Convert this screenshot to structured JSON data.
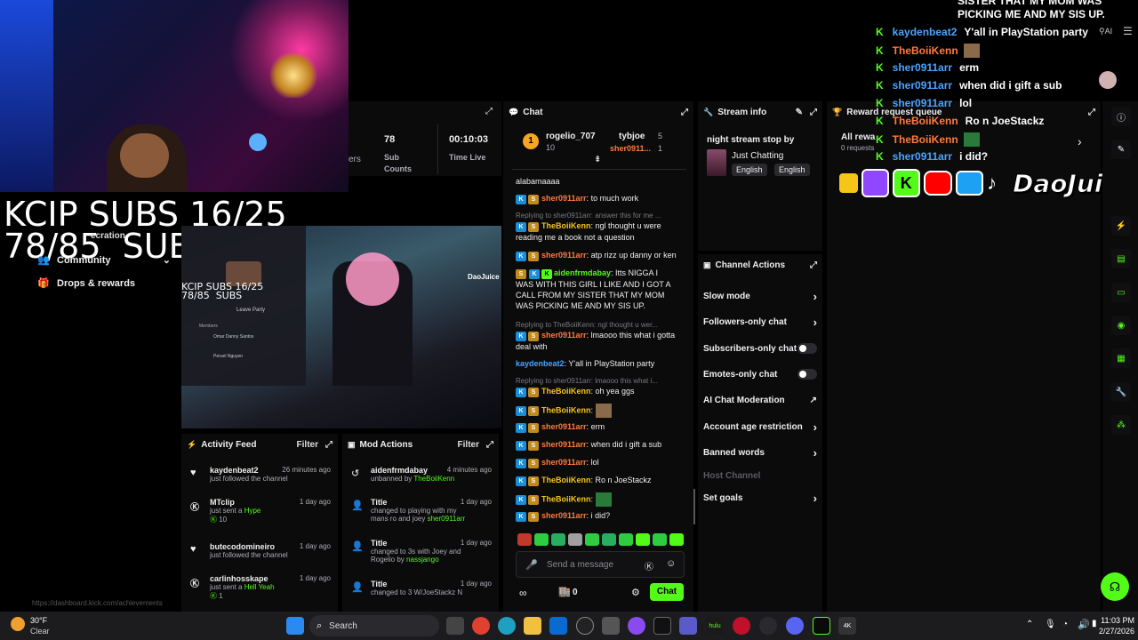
{
  "overlay": {
    "top_text_1": "SISTER THAT MY MOM WAS",
    "top_text_2": "PICKING ME AND MY SIS UP.",
    "sub_goal_1": "KCIP SUBS 16/25",
    "sub_goal_2": "78/85  SUBS",
    "ai_label": "AI",
    "chat_lines": [
      {
        "user": "kaydenbeat2",
        "text": "Y'all in PlayStation party",
        "color": "#4aa3ff"
      },
      {
        "user": "TheBoiiKenn",
        "text": "",
        "color": "#ff7a3c"
      },
      {
        "user": "sher0911arr",
        "text": "erm",
        "color": "#4aa3ff"
      },
      {
        "user": "sher0911arr",
        "text": "when did i gift a sub",
        "color": "#4aa3ff"
      },
      {
        "user": "sher0911arr",
        "text": "lol",
        "color": "#4aa3ff"
      },
      {
        "user": "TheBoiiKenn",
        "text": "Ro n JoeStackz",
        "color": "#ff7a3c"
      },
      {
        "user": "TheBoiiKenn",
        "text": "",
        "color": "#ff7a3c"
      },
      {
        "user": "sher0911arr",
        "text": "i did?",
        "color": "#4aa3ff"
      }
    ],
    "brand": "DaoJuice"
  },
  "left_nav": {
    "items": [
      "Community",
      "Drops & rewards"
    ],
    "partial": "ecration"
  },
  "stats": {
    "subs_value": "78",
    "subs_label_1": "Sub",
    "subs_label_2": "Counts",
    "partial_label": "ers",
    "time_value": "00:10:03",
    "time_label": "Time Live"
  },
  "preview": {
    "goal_1": "KCIP SUBS 16/25",
    "goal_2": "78/85  SUBS",
    "leave_party": "Leave Party",
    "members_label": "Members",
    "member_1": "Omar Danny Santos",
    "member_2": "Peruel Nguyen",
    "brand": "DaoJuice"
  },
  "chat": {
    "title": "Chat",
    "top_user_1": "rogelio_707",
    "top_user_1_rank": "1",
    "top_user_1_count": "10",
    "top_user_2": "tybjoe",
    "top_user_2_count": "5",
    "top_user_3": "sher0911...",
    "top_user_3_count": "1",
    "partial_msg": "alabamaaaa",
    "messages": [
      {
        "user": "sher0911arr",
        "text": "to much work",
        "reply": ""
      },
      {
        "user": "TheBoiiKenn",
        "text": "ngl thought u were reading me a book not a question",
        "reply": "Replying to sher0911arr: answer this for me ..."
      },
      {
        "user": "sher0911arr",
        "text": "atp rizz up danny or ken",
        "reply": ""
      },
      {
        "user": "aidenfrmdabay",
        "text": "Itts NIGGA I WAS WITH THIS GIRL I LIKE AND I GOT A CALL FROM MY SISTER THAT MY MOM WAS PICKING ME AND MY SIS UP.",
        "reply": ""
      },
      {
        "user": "sher0911arr",
        "text": "lmaooo this what i gotta deal with",
        "reply": "Replying to TheBoiiKenn: ngl thought u wer..."
      },
      {
        "user": "kaydenbeat2",
        "text": "Y'all in PlayStation party",
        "reply": ""
      },
      {
        "user": "TheBoiiKenn",
        "text": "oh yea ggs",
        "reply": "Replying to sher0911arr: lmaooo this what i..."
      },
      {
        "user": "TheBoiiKenn",
        "text": "",
        "reply": ""
      },
      {
        "user": "sher0911arr",
        "text": "erm",
        "reply": ""
      },
      {
        "user": "sher0911arr",
        "text": "when did i gift a sub",
        "reply": ""
      },
      {
        "user": "sher0911arr",
        "text": "lol",
        "reply": ""
      },
      {
        "user": "TheBoiiKenn",
        "text": "Ro n JoeStackz",
        "reply": ""
      },
      {
        "user": "TheBoiiKenn",
        "text": "",
        "reply": ""
      },
      {
        "user": "sher0911arr",
        "text": "i did?",
        "reply": ""
      }
    ],
    "placeholder": "Send a message",
    "viewer_count": "0",
    "chat_button": "Chat"
  },
  "stream_info": {
    "title": "Stream info",
    "stream_title": "night stream stop by",
    "category": "Just Chatting",
    "tag_1": "English",
    "tag_2": "English"
  },
  "channel_actions": {
    "title": "Channel Actions",
    "items": [
      "Slow mode",
      "Followers-only chat",
      "Subscribers-only chat",
      "Emotes-only chat",
      "AI Chat Moderation",
      "Account age restriction",
      "Banned words",
      "Host Channel",
      "Set goals"
    ]
  },
  "reward_queue": {
    "title": "Reward request queue",
    "all_rewards": "All rewa",
    "requests": "0 requests"
  },
  "activity_feed": {
    "title": "Activity Feed",
    "filter": "Filter",
    "items": [
      {
        "name": "kaydenbeat2",
        "time": "26 minutes ago",
        "line": "just followed the channel",
        "extra": ""
      },
      {
        "name": "MTclip",
        "time": "1 day ago",
        "line": "just sent a",
        "highlight": "Hype",
        "extra": "10"
      },
      {
        "name": "butecodomineiro",
        "time": "1 day ago",
        "line": "just followed the channel",
        "extra": ""
      },
      {
        "name": "carlinhosskape",
        "time": "1 day ago",
        "line": "just sent a",
        "highlight": "Hell Yeah",
        "extra": "1"
      }
    ]
  },
  "mod_actions": {
    "title": "Mod Actions",
    "filter": "Filter",
    "items": [
      {
        "name": "aidenfrmdabay",
        "time": "4 minutes ago",
        "line": "unbanned by",
        "by": "TheBoiiKenn"
      },
      {
        "name": "Title",
        "time": "1 day ago",
        "line": "changed to playing with my mans ro and joey",
        "by": "sher0911arr"
      },
      {
        "name": "Title",
        "time": "1 day ago",
        "line": "changed to 3s with Joey and Rogelio by",
        "by": "nassjango"
      },
      {
        "name": "Title",
        "time": "1 day ago",
        "line": "changed to 3 W/JoeStackz N",
        "by": ""
      }
    ]
  },
  "url_hint": "https://dashboard.kick.com/achievements",
  "taskbar": {
    "temp": "30°F",
    "weather": "Clear",
    "search": "Search",
    "time": "11:03 PM",
    "date": "2/27/2026"
  },
  "colors": {
    "accent": "#53fc18",
    "panel": "#0b0b0c"
  }
}
